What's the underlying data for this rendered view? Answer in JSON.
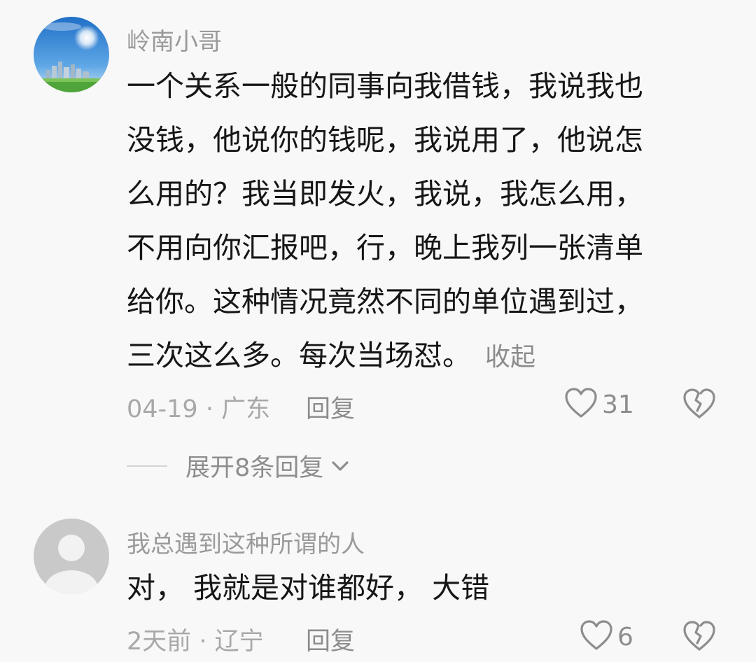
{
  "comments": [
    {
      "username": "岭南小哥",
      "lines": [
        "一个关系一般的同事向我借钱，我说我也",
        "没钱，他说你的钱呢，我说用了，他说怎",
        "么用的？我当即发火，我说，我怎么用，",
        "不用向你汇报吧，行，晚上我列一张清单",
        "给你。这种情况竟然不同的单位遇到过，",
        "三次这么多。每次当场怼。"
      ],
      "collapse_label": "收起",
      "date": "04-19",
      "location": "广东",
      "reply_label": "回复",
      "likes": "31",
      "expand_label": "展开8条回复"
    },
    {
      "username": "我总遇到这种所谓的人",
      "text": "对， 我就是对谁都好， 大错",
      "date": "2天前",
      "location": "辽宁",
      "reply_label": "回复",
      "likes": "6"
    }
  ],
  "meta_separator": " · ",
  "icons": {
    "like": "heart-outline-icon",
    "dislike": "broken-heart-icon",
    "expand": "chevron-down-icon"
  }
}
